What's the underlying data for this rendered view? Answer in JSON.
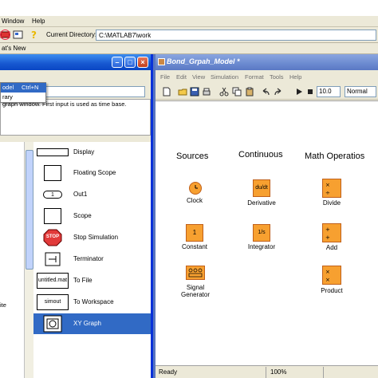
{
  "matlab": {
    "menu": {
      "window": "Window",
      "help": "Help"
    },
    "current_dir_label": "Current Directory:",
    "current_dir_value": "C:\\MATLAB7\\work",
    "whats_new": "at's New"
  },
  "library": {
    "context_menu": {
      "item1": "odel",
      "item1_shortcut": "Ctrl+N",
      "item2": "rary"
    },
    "description": "graph window. First input is used as time base.",
    "tree_partial": "ite",
    "blocks": [
      {
        "icon_text": "",
        "label": "Display"
      },
      {
        "icon_text": "",
        "label": "Floating Scope"
      },
      {
        "icon_text": "1",
        "label": "Out1"
      },
      {
        "icon_text": "",
        "label": "Scope"
      },
      {
        "icon_text": "STOP",
        "label": "Stop Simulation"
      },
      {
        "icon_text": "",
        "label": "Terminator"
      },
      {
        "icon_text": "untitled.mat",
        "label": "To File"
      },
      {
        "icon_text": "simout",
        "label": "To Workspace"
      },
      {
        "icon_text": "",
        "label": "XY Graph"
      }
    ]
  },
  "model": {
    "title": "Bond_Grpah_Model *",
    "menu": [
      "File",
      "Edit",
      "View",
      "Simulation",
      "Format",
      "Tools",
      "Help"
    ],
    "stop_time": "10.0",
    "sim_mode": "Normal",
    "columns": {
      "sources": "Sources",
      "continuous": "Continuous",
      "math": "Math Operatios"
    },
    "blocks": {
      "clock": "Clock",
      "constant": "Constant",
      "constant_value": "1",
      "signal_generator_1": "Signal",
      "signal_generator_2": "Generator",
      "derivative": "Derivative",
      "derivative_icon": "du/dt",
      "integrator": "Integrator",
      "integrator_icon": "1/s",
      "divide": "Divide",
      "add": "Add",
      "product": "Product"
    },
    "status": {
      "left": "Ready",
      "zoom": "100%"
    }
  },
  "colors": {
    "block_fill": "#f7a030",
    "selection": "#316ac5",
    "titlebar_active": "#0a46c4"
  }
}
